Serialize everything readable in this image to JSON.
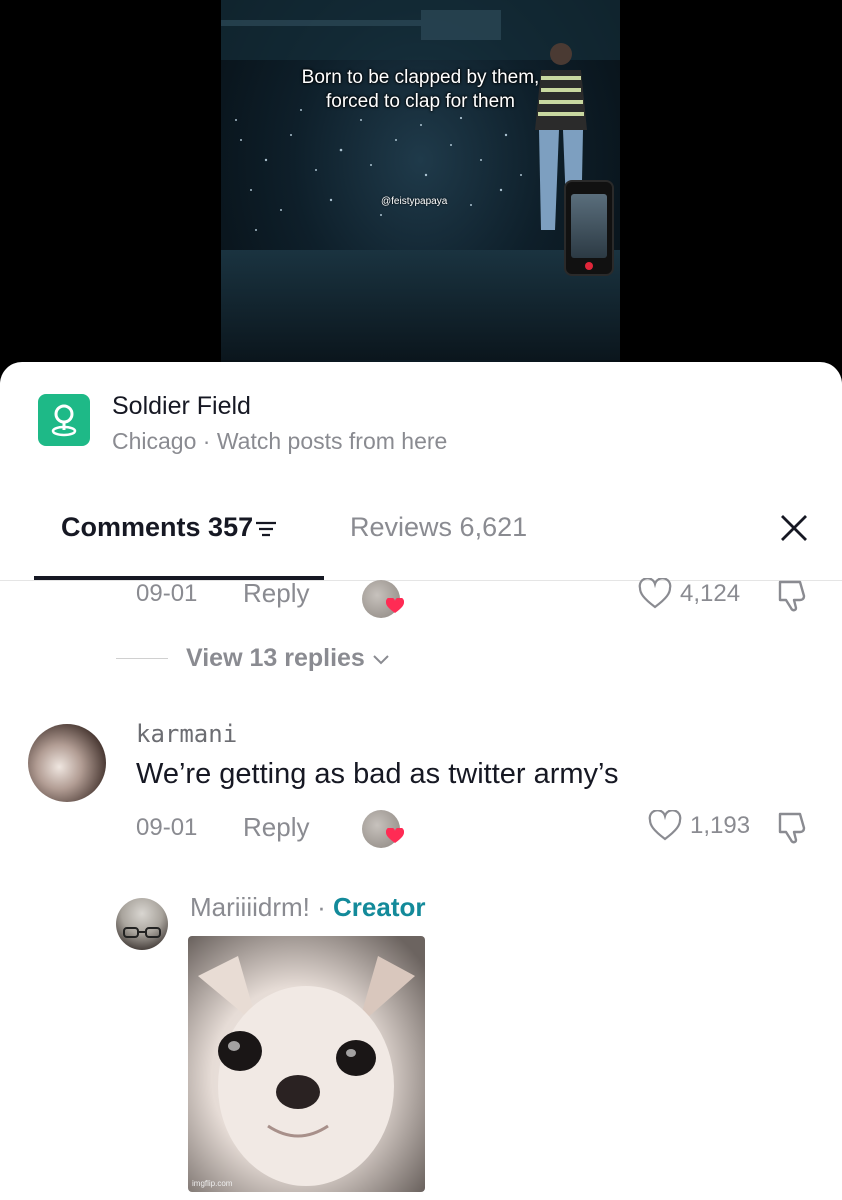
{
  "video": {
    "caption_line1": "Born to be clapped by them,",
    "caption_line2": "forced to clap for them",
    "watermark": "@feistypapaya"
  },
  "location": {
    "name": "Soldier Field",
    "subtitle": "Chicago · Watch posts from here",
    "icon": "map-pin-icon",
    "icon_color": "#1eb987"
  },
  "tabs": {
    "comments_label": "Comments",
    "comments_count": "357",
    "reviews_label": "Reviews",
    "reviews_count": "6,621"
  },
  "comments": [
    {
      "date": "09-01",
      "reply_label": "Reply",
      "likes": "4,124"
    },
    {
      "username": "karmani",
      "text": "We’re getting as bad as twitter army’s",
      "date": "09-01",
      "reply_label": "Reply",
      "likes": "1,193"
    }
  ],
  "view_replies": "View 13 replies",
  "reply": {
    "username": "Mariiiidrm!",
    "separator": "·",
    "badge": "Creator",
    "gif_credit": "imgflip.com"
  },
  "colors": {
    "heart": "#ff2b54",
    "creator": "#138a9a",
    "text_primary": "#161823",
    "text_secondary": "#8a8b91"
  }
}
